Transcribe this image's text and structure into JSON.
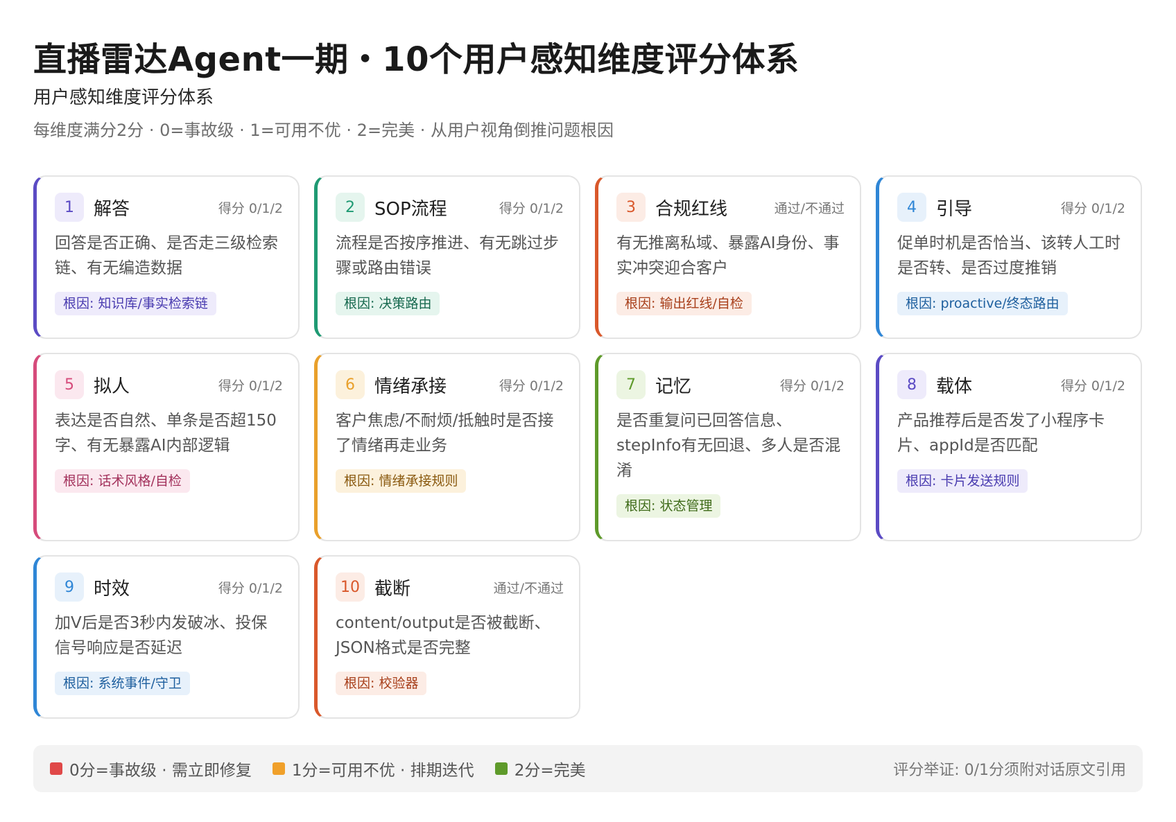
{
  "header": {
    "title": "直播雷达Agent一期・10个用户感知维度评分体系",
    "subtitle": "用户感知维度评分体系",
    "description": "每维度满分2分 · 0=事故级 · 1=可用不优 · 2=完美 · 从用户视角倒推问题根因"
  },
  "cards": [
    {
      "num": "1",
      "name": "解答",
      "score": "得分 0/1/2",
      "body": "回答是否正确、是否走三级检索链、有无编造数据",
      "tag": "根因: 知识库/事实检索链"
    },
    {
      "num": "2",
      "name": "SOP流程",
      "score": "得分 0/1/2",
      "body": "流程是否按序推进、有无跳过步骤或路由错误",
      "tag": "根因: 决策路由"
    },
    {
      "num": "3",
      "name": "合规红线",
      "score": "通过/不通过",
      "body": "有无推离私域、暴露AI身份、事实冲突迎合客户",
      "tag": "根因: 输出红线/自检"
    },
    {
      "num": "4",
      "name": "引导",
      "score": "得分 0/1/2",
      "body": "促单时机是否恰当、该转人工时是否转、是否过度推销",
      "tag": "根因: proactive/终态路由"
    },
    {
      "num": "5",
      "name": "拟人",
      "score": "得分 0/1/2",
      "body": "表达是否自然、单条是否超150字、有无暴露AI内部逻辑",
      "tag": "根因: 话术风格/自检"
    },
    {
      "num": "6",
      "name": "情绪承接",
      "score": "得分 0/1/2",
      "body": "客户焦虑/不耐烦/抵触时是否接了情绪再走业务",
      "tag": "根因: 情绪承接规则"
    },
    {
      "num": "7",
      "name": "记忆",
      "score": "得分 0/1/2",
      "body": "是否重复问已回答信息、stepInfo有无回退、多人是否混淆",
      "tag": "根因: 状态管理"
    },
    {
      "num": "8",
      "name": "载体",
      "score": "得分 0/1/2",
      "body": "产品推荐后是否发了小程序卡片、appId是否匹配",
      "tag": "根因: 卡片发送规则"
    },
    {
      "num": "9",
      "name": "时效",
      "score": "得分 0/1/2",
      "body": "加V后是否3秒内发破冰、投保信号响应是否延迟",
      "tag": "根因: 系统事件/守卫"
    },
    {
      "num": "10",
      "name": "截断",
      "score": "通过/不通过",
      "body": "content/output是否被截断、JSON格式是否完整",
      "tag": "根因: 校验器"
    }
  ],
  "card_colors": [
    {
      "accent": "#5b4bc4",
      "tint": "#eeebfb",
      "tagtext": "#4a3cb0"
    },
    {
      "accent": "#1f9a73",
      "tint": "#e5f5ee",
      "tagtext": "#17694f"
    },
    {
      "accent": "#d9582b",
      "tint": "#fcece5",
      "tagtext": "#a8401c"
    },
    {
      "accent": "#2f86d6",
      "tint": "#e7f1fb",
      "tagtext": "#1e5f9e"
    },
    {
      "accent": "#d64b7b",
      "tint": "#fbe8ef",
      "tagtext": "#a3325c"
    },
    {
      "accent": "#e9a02b",
      "tint": "#fcf1dc",
      "tagtext": "#8a5a10"
    },
    {
      "accent": "#5e9a2a",
      "tint": "#ecf5e2",
      "tagtext": "#3f6b1a"
    },
    {
      "accent": "#5b4bc4",
      "tint": "#eeebfb",
      "tagtext": "#4a3cb0"
    },
    {
      "accent": "#2f86d6",
      "tint": "#e7f1fb",
      "tagtext": "#1e5f9e"
    },
    {
      "accent": "#d9582b",
      "tint": "#fcece5",
      "tagtext": "#a8401c"
    }
  ],
  "legend": {
    "items": [
      {
        "label": "0分=事故级 · 需立即修复",
        "color": "#e04848"
      },
      {
        "label": "1分=可用不优 · 排期迭代",
        "color": "#f0a02a"
      },
      {
        "label": "2分=完美",
        "color": "#5e9a2a"
      }
    ],
    "note": "评分举证: 0/1分须附对话原文引用"
  }
}
